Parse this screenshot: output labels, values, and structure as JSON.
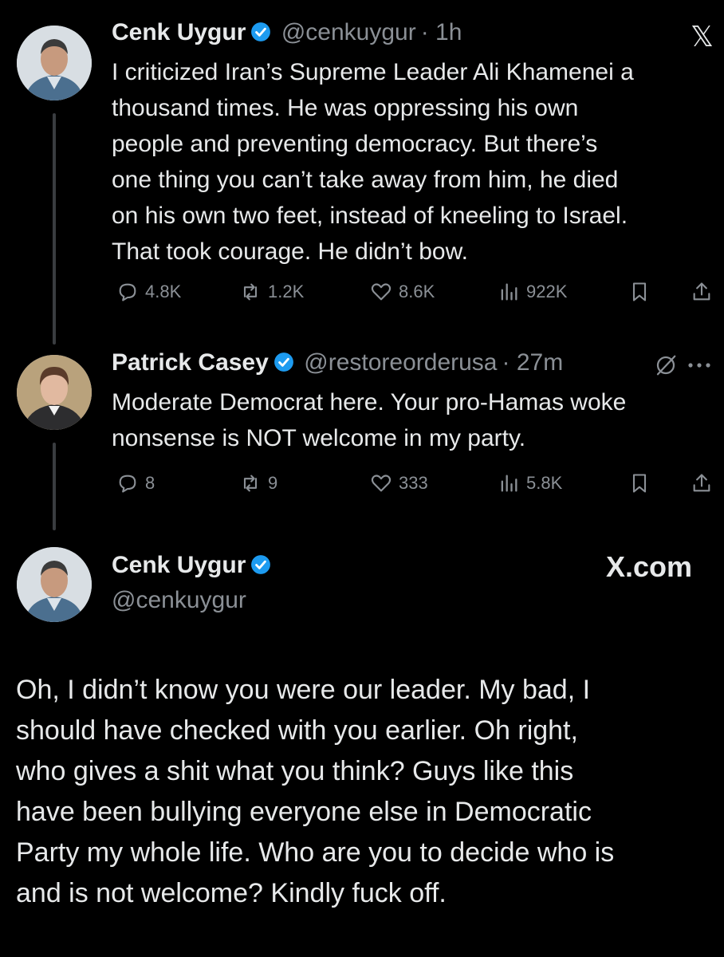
{
  "brand": {
    "x_glyph": "𝕏",
    "site": "X.com"
  },
  "tweet1": {
    "name": "Cenk Uygur",
    "handle": "@cenkuygur",
    "time": "· 1h",
    "lines": [
      "I criticized Iran’s Supreme Leader Ali Khamenei a",
      "thousand times. He was oppressing his own",
      "people and preventing democracy. But there’s",
      "one thing you can’t take away from him, he died",
      "on his own two feet, instead of kneeling to Israel.",
      "That took courage. He didn’t bow."
    ],
    "replies": "4.8K",
    "reposts": "1.2K",
    "likes": "8.6K",
    "views": "922K"
  },
  "tweet2": {
    "name": "Patrick Casey",
    "handle": "@restoreorderusa",
    "time": "· 27m",
    "lines": [
      "Moderate Democrat here. Your pro-Hamas woke",
      "nonsense is NOT welcome in my party."
    ],
    "replies": "8",
    "reposts": "9",
    "likes": "333",
    "views": "5.8K"
  },
  "reply": {
    "name": "Cenk Uygur",
    "handle": "@cenkuygur",
    "lines": [
      "Oh, I didn’t know you were our leader. My bad, I",
      "should have checked with you earlier. Oh right,",
      "who gives a shit what you think? Guys like this",
      "have been bullying everyone else in Democratic",
      "Party my whole life. Who are you to decide who is",
      "and is not welcome? Kindly fuck off."
    ]
  },
  "colors": {
    "background": "#000000",
    "text": "#e7e9ea",
    "muted": "#8b9096",
    "verified": "#1d9bf0"
  }
}
